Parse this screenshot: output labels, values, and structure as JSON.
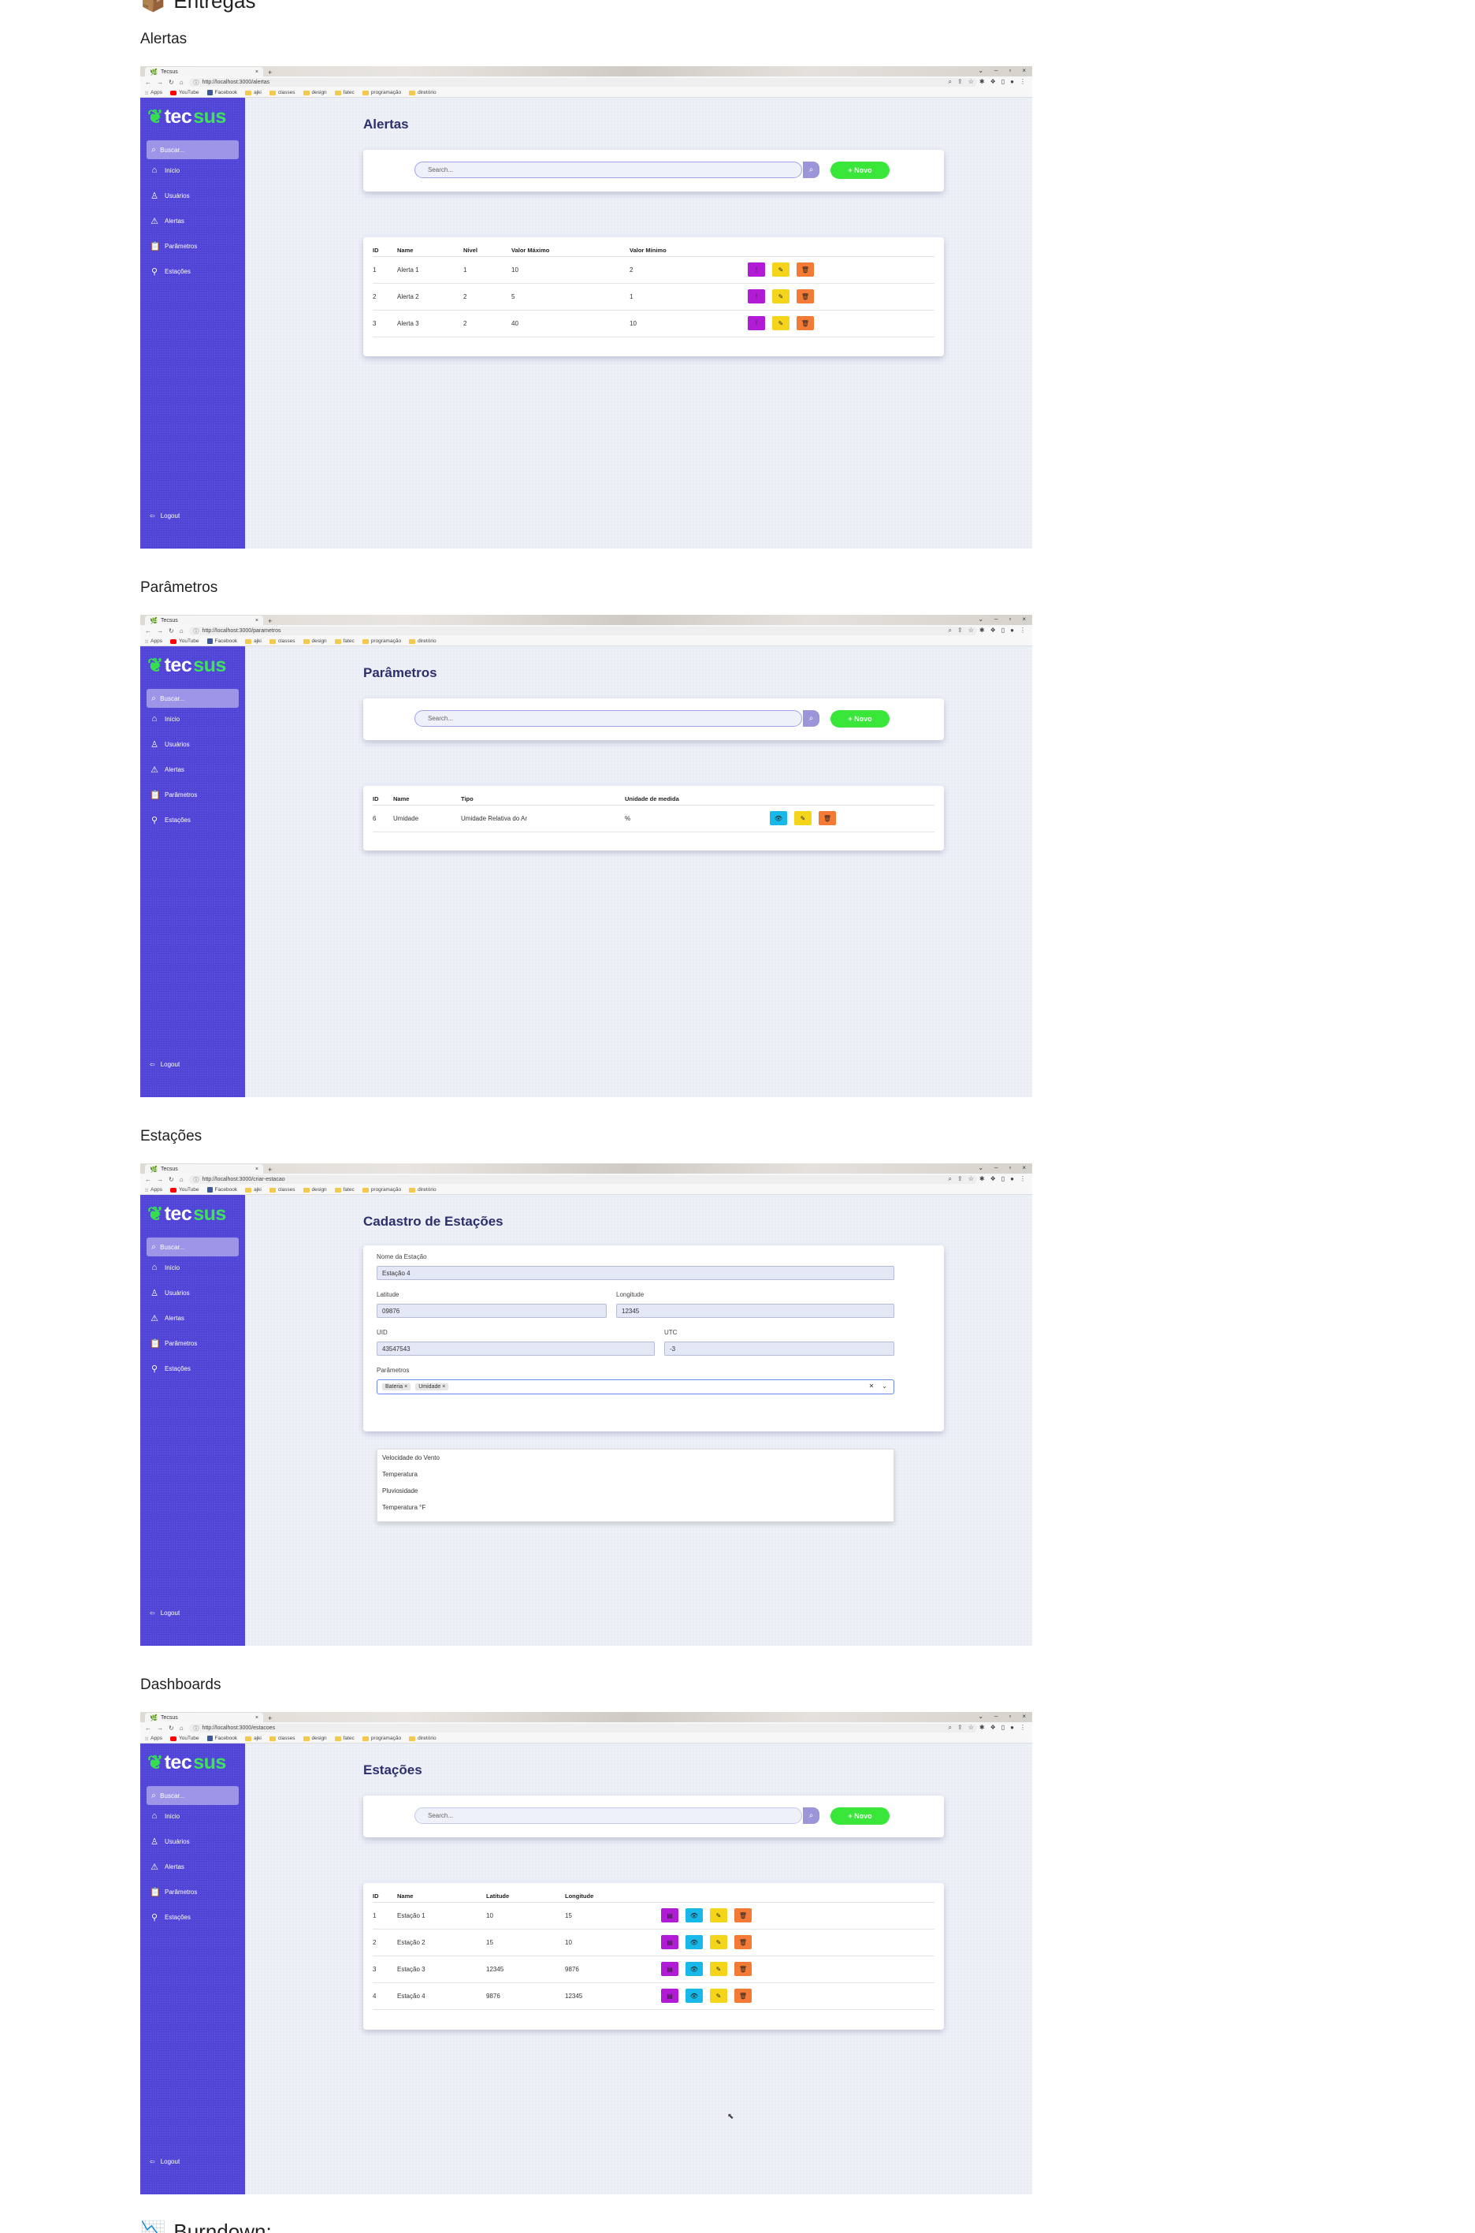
{
  "headings": {
    "top": "Entregas",
    "alertas": "Alertas",
    "parametros": "Parâmetros",
    "estacoes": "Estações",
    "dashboards": "Dashboards",
    "burndown": "Burndown:"
  },
  "browser": {
    "tab_title": "Tecsus",
    "new_tab": "+",
    "urls": {
      "alertas": "http://localhost:3000/alertas",
      "parametros": "http://localhost:3000/parametros",
      "estacoes": "http://localhost:3000/criar-estacao",
      "dashboards": "http://localhost:3000/estacoes"
    },
    "bookmarks": [
      "Apps",
      "YouTube",
      "Facebook",
      "ajki",
      "classes",
      "design",
      "fatec",
      "programação",
      "diretório"
    ]
  },
  "sidebar": {
    "logo_tec": "tec",
    "logo_sus": "sus",
    "search_label": "Buscar...",
    "items": [
      {
        "label": "Início",
        "icon": "home-icon"
      },
      {
        "label": "Usuários",
        "icon": "user-icon"
      },
      {
        "label": "Alertas",
        "icon": "warning-icon"
      },
      {
        "label": "Parâmetros",
        "icon": "clipboard-icon"
      },
      {
        "label": "Estações",
        "icon": "antenna-icon"
      }
    ],
    "logout": "Logout"
  },
  "search": {
    "placeholder": "Search...",
    "new_button": "+ Novo"
  },
  "alertas": {
    "title": "Alertas",
    "columns": [
      "ID",
      "Name",
      "Nível",
      "Valor Máximo",
      "Valor Mínimo"
    ],
    "rows": [
      [
        "1",
        "Alerta 1",
        "1",
        "10",
        "2"
      ],
      [
        "2",
        "Alerta 2",
        "2",
        "5",
        "1"
      ],
      [
        "3",
        "Alerta 3",
        "2",
        "40",
        "10"
      ]
    ]
  },
  "parametros": {
    "title": "Parâmetros",
    "columns": [
      "ID",
      "Name",
      "Tipo",
      "Unidade de medida"
    ],
    "rows": [
      [
        "6",
        "Umidade",
        "Umidade Relativa do Ar",
        "%"
      ]
    ]
  },
  "cadastro": {
    "title": "Cadastro de Estações",
    "nome_label": "Nome da Estação",
    "nome_value": "Estação 4",
    "latitude_label": "Latitude",
    "latitude_value": "09876",
    "longitude_label": "Longitude",
    "longitude_value": "12345",
    "uid_label": "UID",
    "uid_value": "43547543",
    "utc_label": "UTC",
    "utc_value": "-3",
    "parametros_label": "Parâmetros",
    "selected": [
      "Bateria",
      "Umidade"
    ],
    "options": [
      "Velocidade do Vento",
      "Temperatura",
      "Pluviosidade",
      "Temperatura °F"
    ]
  },
  "estacoes": {
    "title": "Estações",
    "columns": [
      "ID",
      "Name",
      "Latitude",
      "Longitude"
    ],
    "rows": [
      [
        "1",
        "Estação 1",
        "10",
        "15"
      ],
      [
        "2",
        "Estação 2",
        "15",
        "10"
      ],
      [
        "3",
        "Estação 3",
        "12345",
        "9876"
      ],
      [
        "4",
        "Estação 4",
        "9876",
        "12345"
      ]
    ]
  }
}
